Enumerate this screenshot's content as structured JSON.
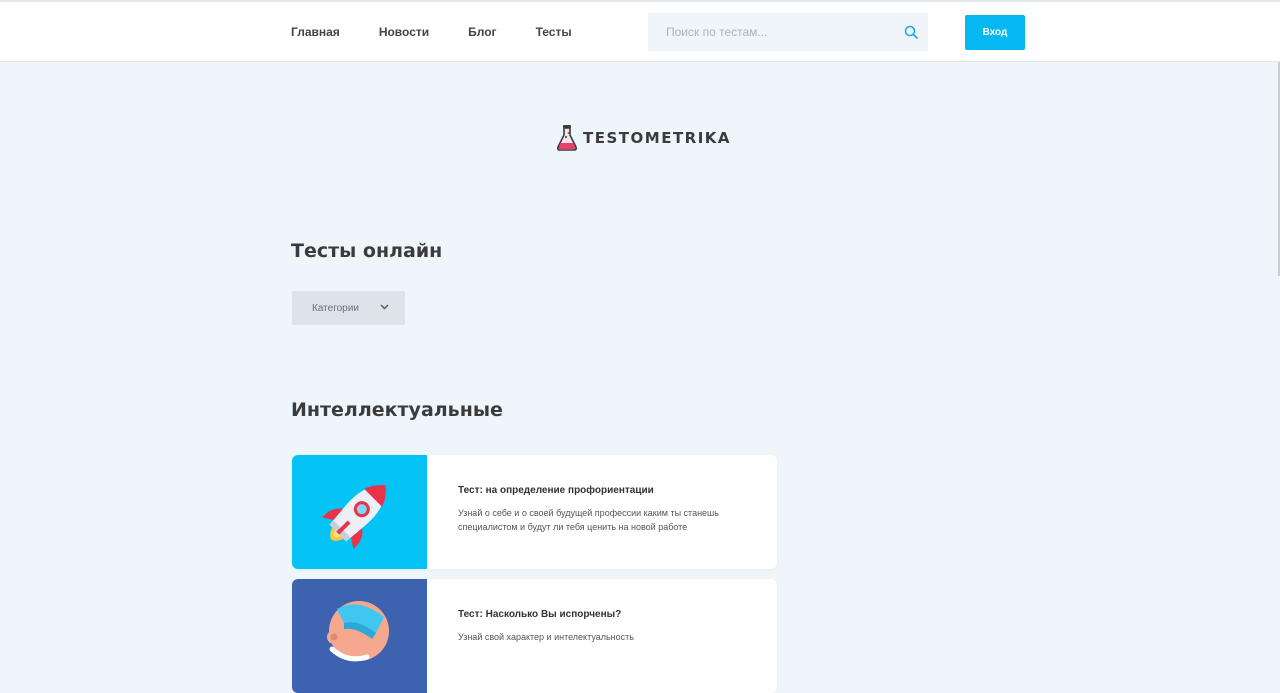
{
  "nav": {
    "items": [
      {
        "label": "Главная"
      },
      {
        "label": "Новости"
      },
      {
        "label": "Блог"
      },
      {
        "label": "Тесты"
      }
    ]
  },
  "search": {
    "placeholder": "Поиск по тестам...",
    "icon": "search-icon"
  },
  "login": {
    "label": "Вход"
  },
  "logo": {
    "text": "TESTOMETRIKA",
    "icon": "flask-icon"
  },
  "main": {
    "heading": "Тесты онлайн",
    "categories_label": "Категории",
    "section_heading": "Интеллектуальные",
    "cards": [
      {
        "title": "Тест: на определение профориентации",
        "description": "Узнай о себе и о своей будущей профессии каким ты станешь специалистом и будут ли тебя ценить на новой работе",
        "image": "rocket-icon",
        "bg_color": "#05c3f5"
      },
      {
        "title": "Тест: Насколько Вы испорчены?",
        "description": "Узнай свой характер и интелектуальность",
        "image": "head-icon",
        "bg_color": "#3d63b0"
      }
    ]
  },
  "colors": {
    "accent": "#05b8f2",
    "page_bg": "#eef5fb"
  }
}
